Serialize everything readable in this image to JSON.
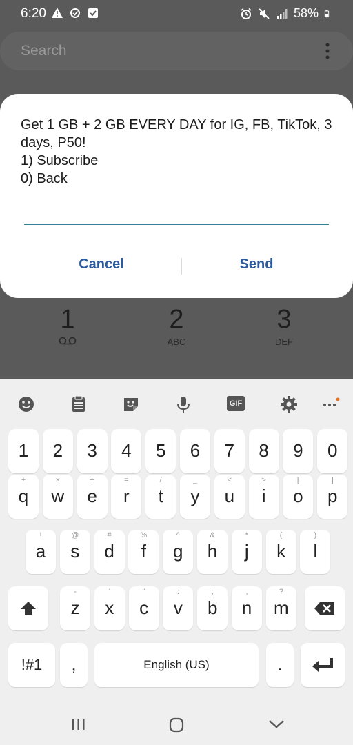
{
  "status_bar": {
    "time": "6:20",
    "battery": "58%",
    "left_icons": [
      "warning-icon",
      "data-saver-icon",
      "checklist-icon"
    ],
    "right_icons": [
      "alarm-icon",
      "mute-icon",
      "signal-icon",
      "battery-icon"
    ]
  },
  "search": {
    "placeholder": "Search"
  },
  "dialog": {
    "message": "Get 1 GB + 2 GB EVERY DAY for IG, FB, TikTok, 3 days, P50!\n1) Subscribe\n0) Back",
    "input_value": "",
    "cancel_label": "Cancel",
    "send_label": "Send",
    "accent_color": "#2c5a9e"
  },
  "dialpad": {
    "keys": [
      {
        "digit": "1",
        "letters": ""
      },
      {
        "digit": "2",
        "letters": "ABC"
      },
      {
        "digit": "3",
        "letters": "DEF"
      }
    ]
  },
  "keyboard": {
    "toolbar_icons": [
      "emoji-icon",
      "clipboard-icon",
      "sticker-icon",
      "microphone-icon",
      "gif-icon",
      "settings-icon",
      "more-options-icon"
    ],
    "gif_label": "GIF",
    "number_row": [
      "1",
      "2",
      "3",
      "4",
      "5",
      "6",
      "7",
      "8",
      "9",
      "0"
    ],
    "row1": [
      {
        "key": "q",
        "sub": "+"
      },
      {
        "key": "w",
        "sub": "×"
      },
      {
        "key": "e",
        "sub": "÷"
      },
      {
        "key": "r",
        "sub": "="
      },
      {
        "key": "t",
        "sub": "/"
      },
      {
        "key": "y",
        "sub": "_"
      },
      {
        "key": "u",
        "sub": "<"
      },
      {
        "key": "i",
        "sub": ">"
      },
      {
        "key": "o",
        "sub": "["
      },
      {
        "key": "p",
        "sub": "]"
      }
    ],
    "row2": [
      {
        "key": "a",
        "sub": "!"
      },
      {
        "key": "s",
        "sub": "@"
      },
      {
        "key": "d",
        "sub": "#"
      },
      {
        "key": "f",
        "sub": "%"
      },
      {
        "key": "g",
        "sub": "^"
      },
      {
        "key": "h",
        "sub": "&"
      },
      {
        "key": "j",
        "sub": "*"
      },
      {
        "key": "k",
        "sub": "("
      },
      {
        "key": "l",
        "sub": ")"
      }
    ],
    "row3": [
      {
        "key": "z",
        "sub": "-"
      },
      {
        "key": "x",
        "sub": "'"
      },
      {
        "key": "c",
        "sub": "\""
      },
      {
        "key": "v",
        "sub": ":"
      },
      {
        "key": "b",
        "sub": ";"
      },
      {
        "key": "n",
        "sub": ","
      },
      {
        "key": "m",
        "sub": "?"
      }
    ],
    "symbols_label": "!#1",
    "comma_label": ",",
    "space_label": "English (US)",
    "period_label": "."
  },
  "navbar": {
    "icons": [
      "recents-icon",
      "home-icon",
      "back-icon"
    ]
  }
}
